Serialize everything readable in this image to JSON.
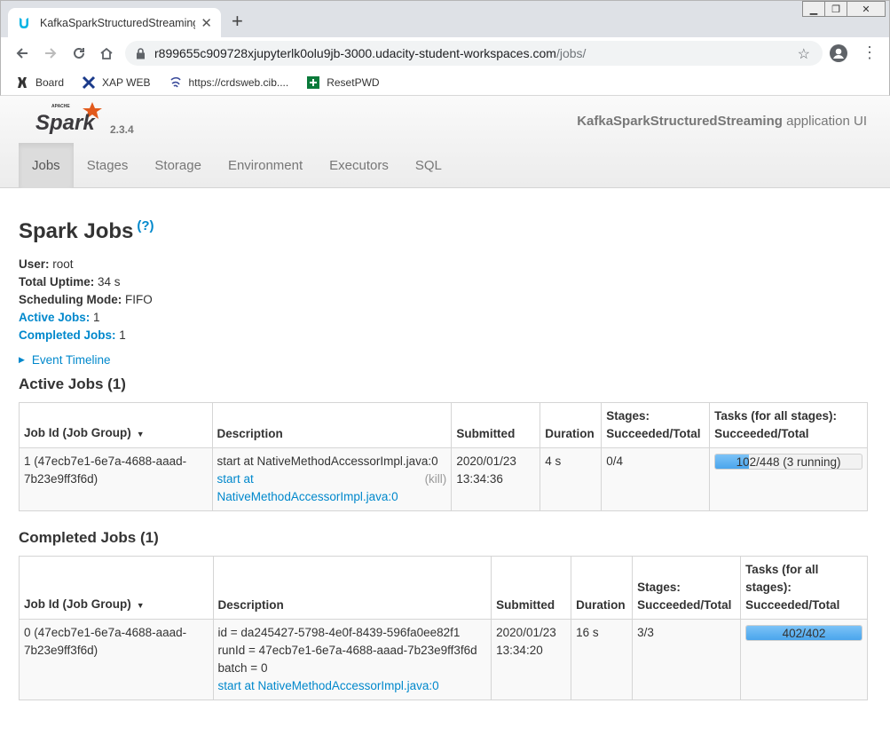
{
  "browser": {
    "tab_title": "KafkaSparkStructuredStreaming",
    "tab_close": "✕",
    "new_tab": "+",
    "url_host": "r899655c909728xjupyterlk0olu9jb-3000.udacity-student-workspaces.com",
    "url_path": "/jobs/",
    "bookmarks": [
      {
        "label": "Board",
        "icon": "board-icon"
      },
      {
        "label": "XAP WEB",
        "icon": "xap-icon"
      },
      {
        "label": "https://crdsweb.cib....",
        "icon": "crdsweb-icon"
      },
      {
        "label": "ResetPWD",
        "icon": "resetpwd-icon"
      }
    ]
  },
  "header": {
    "version": "2.3.4",
    "app_name": "KafkaSparkStructuredStreaming",
    "app_suffix": " application UI",
    "nav": [
      "Jobs",
      "Stages",
      "Storage",
      "Environment",
      "Executors",
      "SQL"
    ],
    "active_nav": "Jobs"
  },
  "page": {
    "title": "Spark Jobs",
    "help": "(?)",
    "summary": {
      "user_label": "User:",
      "user": " root",
      "uptime_label": "Total Uptime:",
      "uptime": " 34 s",
      "mode_label": "Scheduling Mode:",
      "mode": " FIFO",
      "active_label": "Active Jobs:",
      "active": " 1",
      "completed_label": "Completed Jobs:",
      "completed": " 1"
    },
    "event_timeline": "Event Timeline"
  },
  "active_jobs": {
    "heading": "Active Jobs (1)",
    "columns": [
      "Job Id (Job Group)",
      "Description",
      "Submitted",
      "Duration",
      "Stages: Succeeded/Total",
      "Tasks (for all stages): Succeeded/Total"
    ],
    "rows": [
      {
        "job_id": "1 (47ecb7e1-6e7a-4688-aaad-7b23e9ff3f6d)",
        "desc_line": "start at NativeMethodAccessorImpl.java:0",
        "desc_link": "start at NativeMethodAccessorImpl.java:0",
        "kill": "(kill)",
        "submitted": "2020/01/23 13:34:36",
        "duration": "4 s",
        "stages": "0/4",
        "tasks_text": "102/448 (3 running)",
        "tasks_progress": 0.228
      }
    ]
  },
  "completed_jobs": {
    "heading": "Completed Jobs (1)",
    "columns": [
      "Job Id (Job Group)",
      "Description",
      "Submitted",
      "Duration",
      "Stages: Succeeded/Total",
      "Tasks (for all stages): Succeeded/Total"
    ],
    "rows": [
      {
        "job_id": "0 (47ecb7e1-6e7a-4688-aaad-7b23e9ff3f6d)",
        "desc_id": "id = da245427-5798-4e0f-8439-596fa0ee82f1",
        "desc_runid": "runId = 47ecb7e1-6e7a-4688-aaad-7b23e9ff3f6d",
        "desc_batch": "batch = 0",
        "desc_link": "start at NativeMethodAccessorImpl.java:0",
        "submitted": "2020/01/23 13:34:20",
        "duration": "16 s",
        "stages": "3/3",
        "tasks_text": "402/402",
        "tasks_progress": 1.0
      }
    ]
  },
  "colors": {
    "link": "#0088cc",
    "progress": "#4aa5ec",
    "brand_orange": "#e25a1c"
  }
}
